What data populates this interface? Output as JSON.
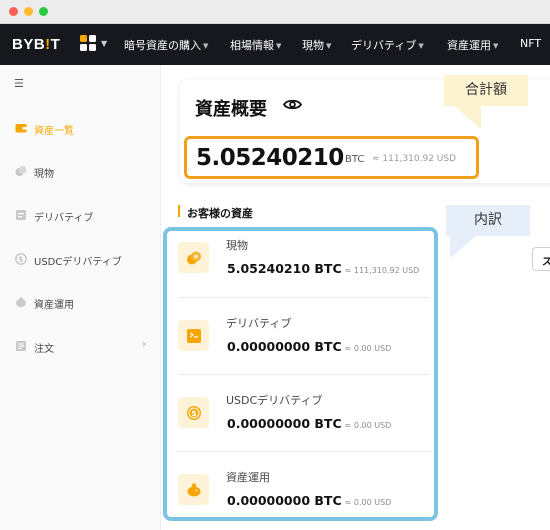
{
  "app": {
    "logo_prefix": "BYB",
    "logo_bang": "!",
    "logo_suffix": "T"
  },
  "nav": {
    "items": [
      {
        "label": "暗号資産の購入"
      },
      {
        "label": "相場情報"
      },
      {
        "label": "現物"
      },
      {
        "label": "デリバティブ"
      },
      {
        "label": "資産運用"
      },
      {
        "label": "NFT"
      }
    ]
  },
  "sidebar": {
    "items": [
      {
        "label": "資産一覧",
        "icon": "wallet-icon",
        "active": true
      },
      {
        "label": "現物",
        "icon": "coins-icon"
      },
      {
        "label": "デリバティブ",
        "icon": "chart-icon"
      },
      {
        "label": "USDCデリバティブ",
        "icon": "usdc-icon"
      },
      {
        "label": "資産運用",
        "icon": "piggy-bank-icon"
      },
      {
        "label": "注文",
        "icon": "order-icon",
        "chevron": "›"
      }
    ]
  },
  "summary": {
    "title": "資産概要",
    "total_value": "5.05240210",
    "unit": "BTC",
    "approx_usd": "≈ 111,310.92 USD"
  },
  "annotations": {
    "total_label": "合計額",
    "breakdown_label": "内訳"
  },
  "section": {
    "title": "お客様の資産",
    "right_button": "ス"
  },
  "assets": [
    {
      "name": "現物",
      "amount": "5.05240210",
      "unit": "BTC",
      "approx_usd": "≈ 111,310.92 USD",
      "icon": "coins-icon"
    },
    {
      "name": "デリバティブ",
      "amount": "0.00000000",
      "unit": "BTC",
      "approx_usd": "≈ 0.00 USD",
      "icon": "derivatives-icon"
    },
    {
      "name": "USDCデリバティブ",
      "amount": "0.00000000",
      "unit": "BTC",
      "approx_usd": "≈ 0.00 USD",
      "icon": "usdc-icon"
    },
    {
      "name": "資産運用",
      "amount": "0.00000000",
      "unit": "BTC",
      "approx_usd": "≈ 0.00 USD",
      "icon": "piggy-bank-icon"
    }
  ],
  "colors": {
    "brand": "#f7a600",
    "nav_bg": "#17181e",
    "highlight_total": "#f0a11c",
    "highlight_breakdown": "#7cc4e4"
  }
}
